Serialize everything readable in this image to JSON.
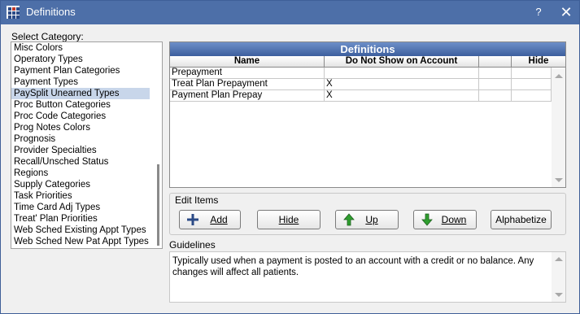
{
  "window": {
    "title": "Definitions",
    "help_label": "?",
    "close_label": "✕"
  },
  "category": {
    "label": "Select Category:",
    "items": [
      "Misc Colors",
      "Operatory Types",
      "Payment Plan Categories",
      "Payment Types",
      "PaySplit Unearned Types",
      "Proc Button Categories",
      "Proc Code Categories",
      "Prog Notes Colors",
      "Prognosis",
      "Provider Specialties",
      "Recall/Unsched Status",
      "Regions",
      "Supply Categories",
      "Task Priorities",
      "Time Card Adj Types",
      "Treat' Plan Priorities",
      "Web Sched Existing Appt Types",
      "Web Sched New Pat Appt Types"
    ],
    "selected": "PaySplit Unearned Types"
  },
  "grid": {
    "title": "Definitions",
    "columns": [
      "Name",
      "Do Not Show on Account",
      "",
      "Hide"
    ],
    "rows": [
      [
        "Prepayment",
        "",
        "",
        ""
      ],
      [
        "Treat Plan Prepayment",
        "X",
        "",
        ""
      ],
      [
        "Payment Plan Prepay",
        "X",
        "",
        ""
      ]
    ]
  },
  "edit_items": {
    "label": "Edit Items",
    "add": "Add",
    "hide": "Hide",
    "up": "Up",
    "down": "Down",
    "alphabetize": "Alphabetize"
  },
  "guidelines": {
    "label": "Guidelines",
    "text": "Typically used when a payment is posted to an account with a credit or no balance. Any changes will affect all patients."
  },
  "colors": {
    "titlebar": "#4d6fa8",
    "selection": "#c8d6ea",
    "arrow_green": "#2e9e2e"
  }
}
